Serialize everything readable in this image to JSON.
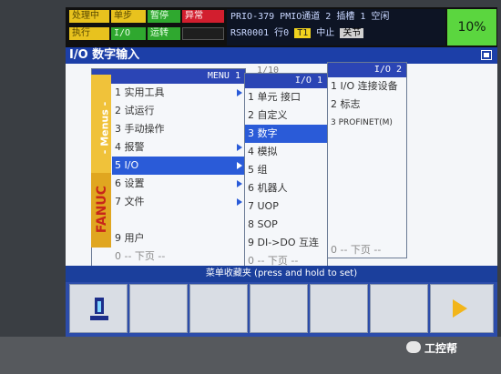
{
  "status": {
    "leds": [
      "处理中",
      "单步",
      "暂停",
      "异常",
      "执行",
      "I/O",
      "运转"
    ],
    "program_line1": "PRIO-379 PMIO通道 2 插槽 1 空闲",
    "program_line2_a": "RSR0001 行0",
    "program_t1": "T1",
    "program_state": "中止",
    "program_flag": "关节",
    "override": "10%"
  },
  "title": "I/O 数字输入",
  "content_header": "1/10",
  "menu_main": {
    "header": "MENU  1",
    "side_label": "- Menus -",
    "logo": "FANUC",
    "items": [
      "1 实用工具",
      "2 试运行",
      "3 手动操作",
      "4 报警",
      "5 I/O",
      "6 设置",
      "7 文件",
      "",
      "9 用户",
      "0 -- 下页 --"
    ]
  },
  "menu_io": {
    "header": "I/O  1",
    "items": [
      "1 单元 接口",
      "2 自定义",
      "3 数字",
      "4 模拟",
      "5 组",
      "6 机器人",
      "7 UOP",
      "8 SOP",
      "9 DI->DO 互连",
      "0 -- 下页 --"
    ]
  },
  "menu_io2": {
    "header": "I/O  2",
    "items": [
      "1 I/O 连接设备",
      "2 标志",
      "3 PROFINET(M)",
      "",
      "",
      "",
      "",
      "",
      "",
      "0 -- 下页 --"
    ]
  },
  "favorites_bar": "菜单收藏夹 (press and hold to set)",
  "watermark": "工控帮",
  "colors": {
    "title_bar": "#1c3fa8",
    "selection": "#2a5bd8",
    "override_bg": "#5bd63f"
  }
}
